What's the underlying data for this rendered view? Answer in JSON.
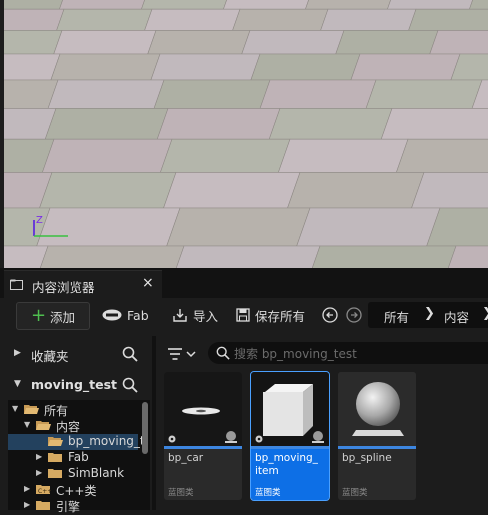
{
  "viewport": {
    "axis_z": "Z"
  },
  "content_browser": {
    "tab_title": "内容浏览器",
    "tab_close": "×",
    "toolbar": {
      "add_label": "添加",
      "fab_label": "Fab",
      "import_label": "导入",
      "save_all_label": "保存所有"
    },
    "breadcrumb": [
      "所有",
      "内容"
    ],
    "favorites_label": "收藏夹",
    "project_label": "moving_test",
    "tree": [
      {
        "label": "所有",
        "level": 0,
        "expanded": true
      },
      {
        "label": "内容",
        "level": 1,
        "expanded": true
      },
      {
        "label": "bp_moving_t",
        "level": 2,
        "selected": true
      },
      {
        "label": "Fab",
        "level": 2
      },
      {
        "label": "SimBlank",
        "level": 2
      },
      {
        "label": "C++类",
        "level": 1
      },
      {
        "label": "引擎",
        "level": 1
      }
    ],
    "search_placeholder": "搜索 bp_moving_test",
    "assets": [
      {
        "name": "bp_car",
        "type": "蓝图类",
        "icon": "disc-thumbnail",
        "selected": false
      },
      {
        "name": "bp_moving_ item",
        "type": "蓝图类",
        "icon": "cube-thumbnail",
        "selected": true
      },
      {
        "name": "bp_spline",
        "type": "蓝图类",
        "icon": "sphere-thumbnail",
        "selected": false
      }
    ],
    "colors": {
      "selection": "#0d6fe6",
      "asset_bar": "#3d86e0",
      "add_plus": "#4fbf4f"
    }
  }
}
